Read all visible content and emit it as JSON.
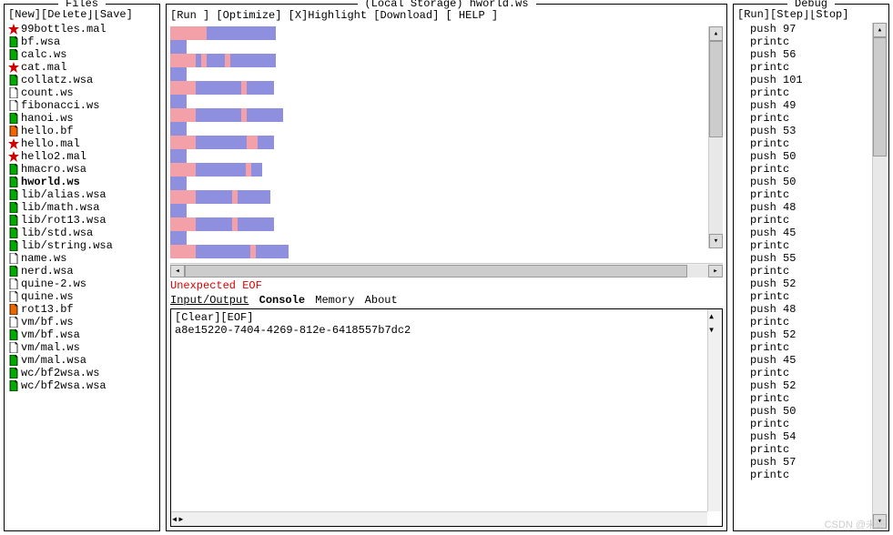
{
  "files": {
    "title": "Files",
    "actions": {
      "new": "[New]",
      "delete": "[Delete]",
      "save": "[Save]"
    },
    "items": [
      {
        "name": "99bottles.mal",
        "icon": "star-red",
        "active": false
      },
      {
        "name": "bf.wsa",
        "icon": "doc-green",
        "active": false
      },
      {
        "name": "calc.ws",
        "icon": "doc-green",
        "active": false
      },
      {
        "name": "cat.mal",
        "icon": "star-red",
        "active": false
      },
      {
        "name": "collatz.wsa",
        "icon": "doc-green",
        "active": false
      },
      {
        "name": "count.ws",
        "icon": "doc",
        "active": false
      },
      {
        "name": "fibonacci.ws",
        "icon": "doc",
        "active": false
      },
      {
        "name": "hanoi.ws",
        "icon": "doc-green",
        "active": false
      },
      {
        "name": "hello.bf",
        "icon": "doc-orange",
        "active": false
      },
      {
        "name": "hello.mal",
        "icon": "star-red",
        "active": false
      },
      {
        "name": "hello2.mal",
        "icon": "star-red",
        "active": false
      },
      {
        "name": "hmacro.wsa",
        "icon": "doc-green",
        "active": false
      },
      {
        "name": "hworld.ws",
        "icon": "doc-green",
        "active": true
      },
      {
        "name": "lib/alias.wsa",
        "icon": "doc-green",
        "active": false
      },
      {
        "name": "lib/math.wsa",
        "icon": "doc-green",
        "active": false
      },
      {
        "name": "lib/rot13.wsa",
        "icon": "doc-green",
        "active": false
      },
      {
        "name": "lib/std.wsa",
        "icon": "doc-green",
        "active": false
      },
      {
        "name": "lib/string.wsa",
        "icon": "doc-green",
        "active": false
      },
      {
        "name": "name.ws",
        "icon": "doc",
        "active": false
      },
      {
        "name": "nerd.wsa",
        "icon": "doc-green",
        "active": false
      },
      {
        "name": "quine-2.ws",
        "icon": "doc",
        "active": false
      },
      {
        "name": "quine.ws",
        "icon": "doc",
        "active": false
      },
      {
        "name": "rot13.bf",
        "icon": "doc-orange",
        "active": false
      },
      {
        "name": "vm/bf.ws",
        "icon": "doc",
        "active": false
      },
      {
        "name": "vm/bf.wsa",
        "icon": "doc-green",
        "active": false
      },
      {
        "name": "vm/mal.ws",
        "icon": "doc",
        "active": false
      },
      {
        "name": "vm/mal.wsa",
        "icon": "doc-green",
        "active": false
      },
      {
        "name": "wc/bf2wsa.ws",
        "icon": "doc-green",
        "active": false
      },
      {
        "name": "wc/bf2wsa.wsa",
        "icon": "doc-green",
        "active": false
      }
    ]
  },
  "editor": {
    "title": "(Local Storage) hworld.ws",
    "actions": {
      "run": "[Run ]",
      "optimize": "[Optimize]",
      "highlight_prefix": "[X]",
      "highlight": "Highlight",
      "download": "[Download]",
      "help": "[ HELP ]"
    },
    "bars": [
      [
        [
          "pink",
          40
        ],
        [
          "blue",
          76
        ]
      ],
      [
        [
          "blue",
          18
        ]
      ],
      [
        [
          "pink",
          28
        ],
        [
          "blue",
          6
        ],
        [
          "pink",
          6
        ],
        [
          "blue",
          20
        ],
        [
          "pink",
          6
        ],
        [
          "blue",
          50
        ]
      ],
      [
        [
          "blue",
          18
        ]
      ],
      [
        [
          "pink",
          28
        ],
        [
          "blue",
          50
        ],
        [
          "pink",
          6
        ],
        [
          "blue",
          30
        ]
      ],
      [
        [
          "blue",
          18
        ]
      ],
      [
        [
          "pink",
          28
        ],
        [
          "blue",
          50
        ],
        [
          "pink",
          6
        ],
        [
          "blue",
          40
        ]
      ],
      [
        [
          "blue",
          18
        ]
      ],
      [
        [
          "pink",
          28
        ],
        [
          "blue",
          56
        ],
        [
          "pink",
          12
        ],
        [
          "blue",
          18
        ]
      ],
      [
        [
          "blue",
          18
        ]
      ],
      [
        [
          "pink",
          28
        ],
        [
          "blue",
          55
        ],
        [
          "pink",
          6
        ],
        [
          "blue",
          12
        ]
      ],
      [
        [
          "blue",
          18
        ]
      ],
      [
        [
          "pink",
          28
        ],
        [
          "blue",
          40
        ],
        [
          "pink",
          6
        ],
        [
          "blue",
          36
        ]
      ],
      [
        [
          "blue",
          18
        ]
      ],
      [
        [
          "pink",
          28
        ],
        [
          "blue",
          40
        ],
        [
          "pink",
          6
        ],
        [
          "blue",
          40
        ]
      ],
      [
        [
          "blue",
          18
        ]
      ],
      [
        [
          "pink",
          28
        ],
        [
          "blue",
          60
        ],
        [
          "pink",
          6
        ],
        [
          "blue",
          36
        ]
      ]
    ],
    "error": "Unexpected EOF",
    "tabs": {
      "io": "Input/Output",
      "console": "Console",
      "memory": "Memory",
      "about": "About",
      "active": "console"
    },
    "console": {
      "clear": "[Clear]",
      "eof": "[EOF]",
      "output": "a8e15220-7404-4269-812e-6418557b7dc2"
    }
  },
  "debug": {
    "title": "Debug",
    "actions": {
      "run": "[Run]",
      "step": "[Step]",
      "stop": "[Stop]"
    },
    "instructions": [
      "push 97",
      "printc",
      "push 56",
      "printc",
      "push 101",
      "printc",
      "push 49",
      "printc",
      "push 53",
      "printc",
      "push 50",
      "printc",
      "push 50",
      "printc",
      "push 48",
      "printc",
      "push 45",
      "printc",
      "push 55",
      "printc",
      "push 52",
      "printc",
      "push 48",
      "printc",
      "push 52",
      "printc",
      "push 45",
      "printc",
      "push 52",
      "printc",
      "push 50",
      "printc",
      "push 54",
      "printc",
      "push 57",
      "printc"
    ]
  },
  "watermark": "CSDN @未研"
}
